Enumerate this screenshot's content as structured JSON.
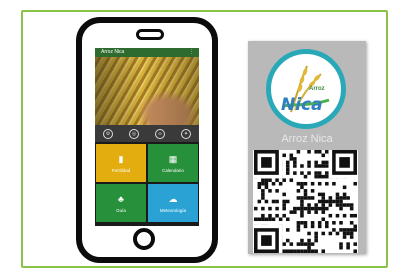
{
  "app": {
    "title": "Arroz Nica",
    "menu_glyph": "⋮"
  },
  "icon_row": [
    {
      "icon": "tractor-icon",
      "glyph": "⚙"
    },
    {
      "icon": "target-icon",
      "glyph": "◎"
    },
    {
      "icon": "link-icon",
      "glyph": "∞"
    },
    {
      "icon": "droplet-icon",
      "glyph": "✦"
    }
  ],
  "tiles": [
    {
      "label": "Fertilidad",
      "icon": "book-icon",
      "glyph": "▮",
      "color": "#e3ad10"
    },
    {
      "label": "Calendario",
      "icon": "calendar-icon",
      "glyph": "▦",
      "color": "#27903a"
    },
    {
      "label": "Guía",
      "icon": "seedling-icon",
      "glyph": "♣",
      "color": "#27903a"
    },
    {
      "label": "Meteorología",
      "icon": "cloud-icon",
      "glyph": "☁",
      "color": "#2aa3d4"
    }
  ],
  "card": {
    "brand": "Nica",
    "brand_top": "Arroz",
    "name": "Arroz Nica"
  },
  "colors": {
    "frame_border": "#8bc34a",
    "app_bar": "#2e6b2f",
    "logo_ring": "#29a9b8"
  }
}
